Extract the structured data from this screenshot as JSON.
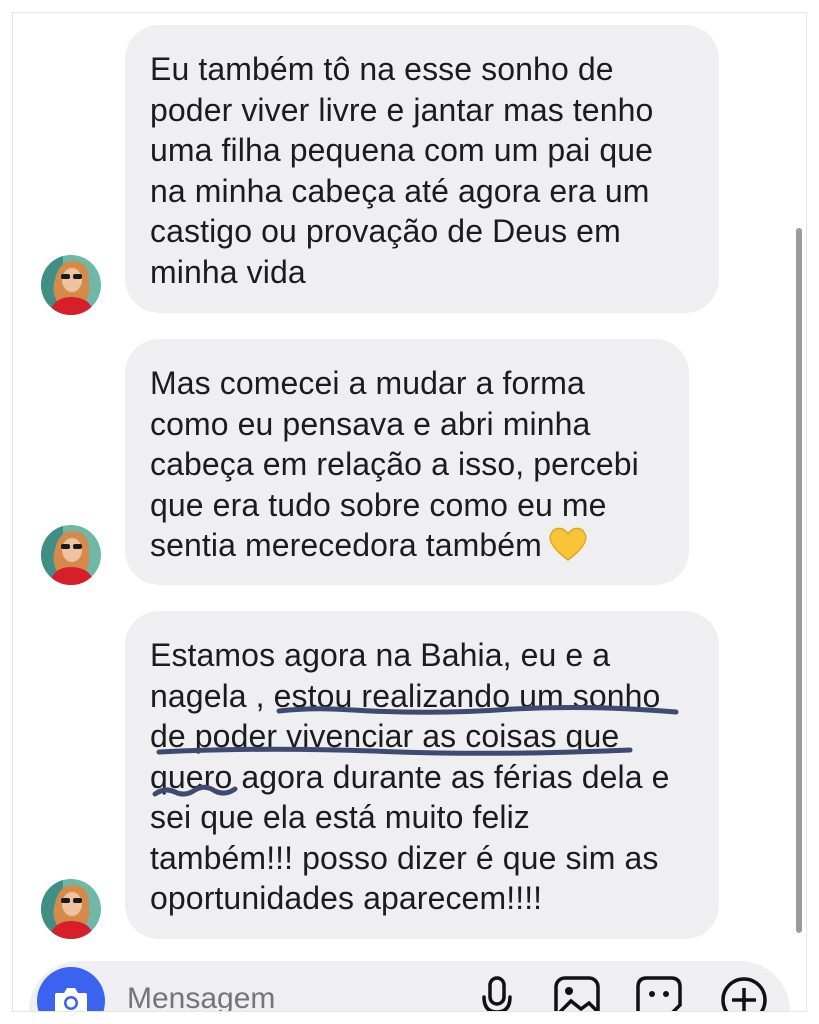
{
  "messages": [
    {
      "text": "Eu também tô na esse sonho de\npoder viver livre e jantar mas tenho\numa filha pequena com um pai que\nna minha cabeça até agora era um\ncastigo ou provação de Deus em\nminha vida"
    },
    {
      "text": "Mas comecei a mudar a forma\ncomo eu pensava e abri minha\ncabeça em relação a isso, percebi\nque era tudo sobre como eu me\nsentia merecedora também",
      "emoji": "yellow-heart-icon"
    },
    {
      "text": "Estamos agora na Bahia, eu e a\nnagela , estou realizando um sonho\nde poder vivenciar as coisas que\nquero agora durante as férias dela e\nsei que ela está muito feliz\ntambém!!!  posso dizer é que sim as\noportunidades aparecem!!!!"
    }
  ],
  "composer": {
    "placeholder": "Mensagem"
  },
  "colors": {
    "bubble": "#efeff1",
    "accent": "#3a63f0",
    "underline": "#3e4a72",
    "heart": "#f7c53a"
  },
  "icons": [
    "camera-icon",
    "microphone-icon",
    "gallery-icon",
    "sticker-icon",
    "add-icon"
  ]
}
